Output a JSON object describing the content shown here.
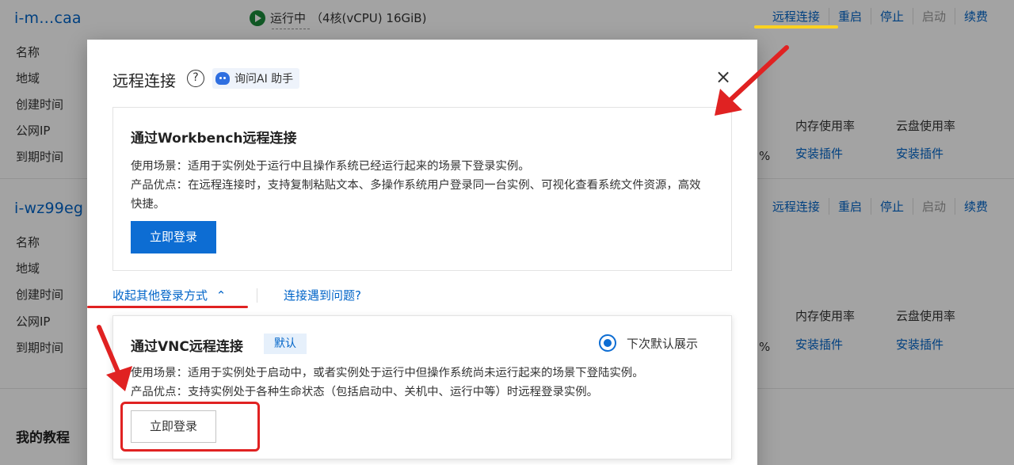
{
  "background": {
    "instance1": {
      "id": "i-m…caa",
      "status": "运行中",
      "spec": "（4核(vCPU) 16GiB)",
      "actions": [
        "远程连接",
        "重启",
        "停止",
        "启动",
        "续费"
      ]
    },
    "instance2": {
      "id": "i-wz99eg",
      "actions": [
        "远程连接",
        "重启",
        "停止",
        "启动",
        "续费"
      ]
    },
    "labels": [
      "名称",
      "地域",
      "创建时间",
      "公网IP",
      "到期时间"
    ],
    "col_memory": "内存使用率",
    "col_disk": "云盘使用率",
    "install_plugin": "安装插件",
    "percent_suffix": "%",
    "tutorial_title": "我的教程"
  },
  "modal": {
    "title": "远程连接",
    "help_icon": "?",
    "ai_label": "询问AI 助手",
    "close_icon": "×",
    "workbench": {
      "title": "通过Workbench远程连接",
      "scenario": "使用场景：适用于实例处于运行中且操作系统已经运行起来的场景下登录实例。",
      "advantage": "产品优点：在远程连接时，支持复制粘贴文本、多操作系统用户登录同一台实例、可视化查看系统文件资源，高效快捷。",
      "login_button": "立即登录"
    },
    "collapse_link": "收起其他登录方式",
    "problem_link": "连接遇到问题?",
    "vnc": {
      "title": "通过VNC远程连接",
      "tag": "默认",
      "radio_label": "下次默认展示",
      "scenario": "使用场景：适用于实例处于启动中，或者实例处于运行中但操作系统尚未运行起来的场景下登陆实例。",
      "advantage": "产品优点：支持实例处于各种生命状态（包括启动中、关机中、运行中等）时远程登录实例。",
      "login_button": "立即登录"
    }
  },
  "colors": {
    "link_blue": "#0064c8",
    "primary_button": "#0d6dd3",
    "annotation_red": "#e02222",
    "annotation_yellow": "#ffd21f"
  }
}
